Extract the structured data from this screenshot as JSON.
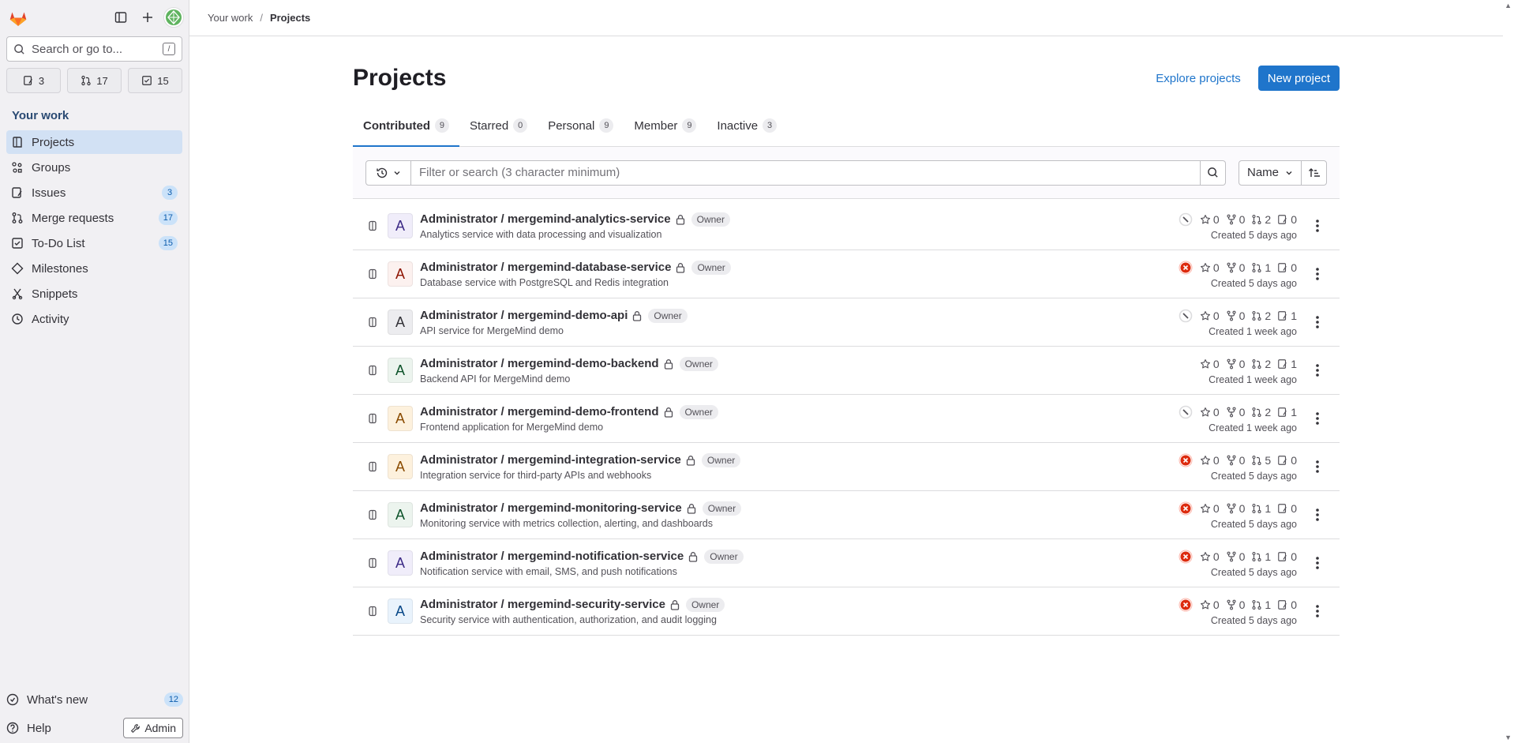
{
  "sidebar": {
    "search_placeholder": "Search or go to...",
    "search_shortcut": "/",
    "counts": {
      "issues": "3",
      "merge_requests": "17",
      "todos": "15"
    },
    "section_title": "Your work",
    "items": [
      {
        "label": "Projects",
        "icon": "project-icon",
        "badge": ""
      },
      {
        "label": "Groups",
        "icon": "group-icon",
        "badge": ""
      },
      {
        "label": "Issues",
        "icon": "issues-icon",
        "badge": "3"
      },
      {
        "label": "Merge requests",
        "icon": "merge-request-icon",
        "badge": "17"
      },
      {
        "label": "To-Do List",
        "icon": "todo-icon",
        "badge": "15"
      },
      {
        "label": "Milestones",
        "icon": "milestone-icon",
        "badge": ""
      },
      {
        "label": "Snippets",
        "icon": "snippet-icon",
        "badge": ""
      },
      {
        "label": "Activity",
        "icon": "activity-icon",
        "badge": ""
      }
    ],
    "whats_new": {
      "label": "What's new",
      "badge": "12"
    },
    "help_label": "Help",
    "admin_label": "Admin"
  },
  "breadcrumb": {
    "parent": "Your work",
    "current": "Projects"
  },
  "header": {
    "title": "Projects",
    "explore_label": "Explore projects",
    "new_project_label": "New project"
  },
  "tabs": [
    {
      "label": "Contributed",
      "count": "9"
    },
    {
      "label": "Starred",
      "count": "0"
    },
    {
      "label": "Personal",
      "count": "9"
    },
    {
      "label": "Member",
      "count": "9"
    },
    {
      "label": "Inactive",
      "count": "3"
    }
  ],
  "filter": {
    "placeholder": "Filter or search (3 character minimum)",
    "sort_label": "Name"
  },
  "colors": {
    "accent": "#1f75cb",
    "pipeline_failed": "#dd2b0e",
    "pipeline_skipped": "#a4a3a8"
  },
  "projects": [
    {
      "name": "Administrator / mergemind-analytics-service",
      "role": "Owner",
      "description": "Analytics service with data processing and visualization",
      "initial": "A",
      "avatar_bg": "#f0edfa",
      "avatar_fg": "#3c2a86",
      "pipeline": "skipped",
      "stars": "0",
      "forks": "0",
      "mrs": "2",
      "issues": "0",
      "created": "Created 5 days ago"
    },
    {
      "name": "Administrator / mergemind-database-service",
      "role": "Owner",
      "description": "Database service with PostgreSQL and Redis integration",
      "initial": "A",
      "avatar_bg": "#fcf1ef",
      "avatar_fg": "#8d1300",
      "pipeline": "failed",
      "stars": "0",
      "forks": "0",
      "mrs": "1",
      "issues": "0",
      "created": "Created 5 days ago"
    },
    {
      "name": "Administrator / mergemind-demo-api",
      "role": "Owner",
      "description": "API service for MergeMind demo",
      "initial": "A",
      "avatar_bg": "#ececef",
      "avatar_fg": "#333238",
      "pipeline": "skipped",
      "stars": "0",
      "forks": "0",
      "mrs": "2",
      "issues": "1",
      "created": "Created 1 week ago"
    },
    {
      "name": "Administrator / mergemind-demo-backend",
      "role": "Owner",
      "description": "Backend API for MergeMind demo",
      "initial": "A",
      "avatar_bg": "#ecf4ee",
      "avatar_fg": "#0d532a",
      "pipeline": "",
      "stars": "0",
      "forks": "0",
      "mrs": "2",
      "issues": "1",
      "created": "Created 1 week ago"
    },
    {
      "name": "Administrator / mergemind-demo-frontend",
      "role": "Owner",
      "description": "Frontend application for MergeMind demo",
      "initial": "A",
      "avatar_bg": "#fdf1dd",
      "avatar_fg": "#8a4b00",
      "pipeline": "skipped",
      "stars": "0",
      "forks": "0",
      "mrs": "2",
      "issues": "1",
      "created": "Created 1 week ago"
    },
    {
      "name": "Administrator / mergemind-integration-service",
      "role": "Owner",
      "description": "Integration service for third-party APIs and webhooks",
      "initial": "A",
      "avatar_bg": "#fdf1dd",
      "avatar_fg": "#8a4b00",
      "pipeline": "failed",
      "stars": "0",
      "forks": "0",
      "mrs": "5",
      "issues": "0",
      "created": "Created 5 days ago"
    },
    {
      "name": "Administrator / mergemind-monitoring-service",
      "role": "Owner",
      "description": "Monitoring service with metrics collection, alerting, and dashboards",
      "initial": "A",
      "avatar_bg": "#ecf4ee",
      "avatar_fg": "#0d532a",
      "pipeline": "failed",
      "stars": "0",
      "forks": "0",
      "mrs": "1",
      "issues": "0",
      "created": "Created 5 days ago"
    },
    {
      "name": "Administrator / mergemind-notification-service",
      "role": "Owner",
      "description": "Notification service with email, SMS, and push notifications",
      "initial": "A",
      "avatar_bg": "#f0edfa",
      "avatar_fg": "#3c2a86",
      "pipeline": "failed",
      "stars": "0",
      "forks": "0",
      "mrs": "1",
      "issues": "0",
      "created": "Created 5 days ago"
    },
    {
      "name": "Administrator / mergemind-security-service",
      "role": "Owner",
      "description": "Security service with authentication, authorization, and audit logging",
      "initial": "A",
      "avatar_bg": "#e9f3fc",
      "avatar_fg": "#064787",
      "pipeline": "failed",
      "stars": "0",
      "forks": "0",
      "mrs": "1",
      "issues": "0",
      "created": "Created 5 days ago"
    }
  ]
}
